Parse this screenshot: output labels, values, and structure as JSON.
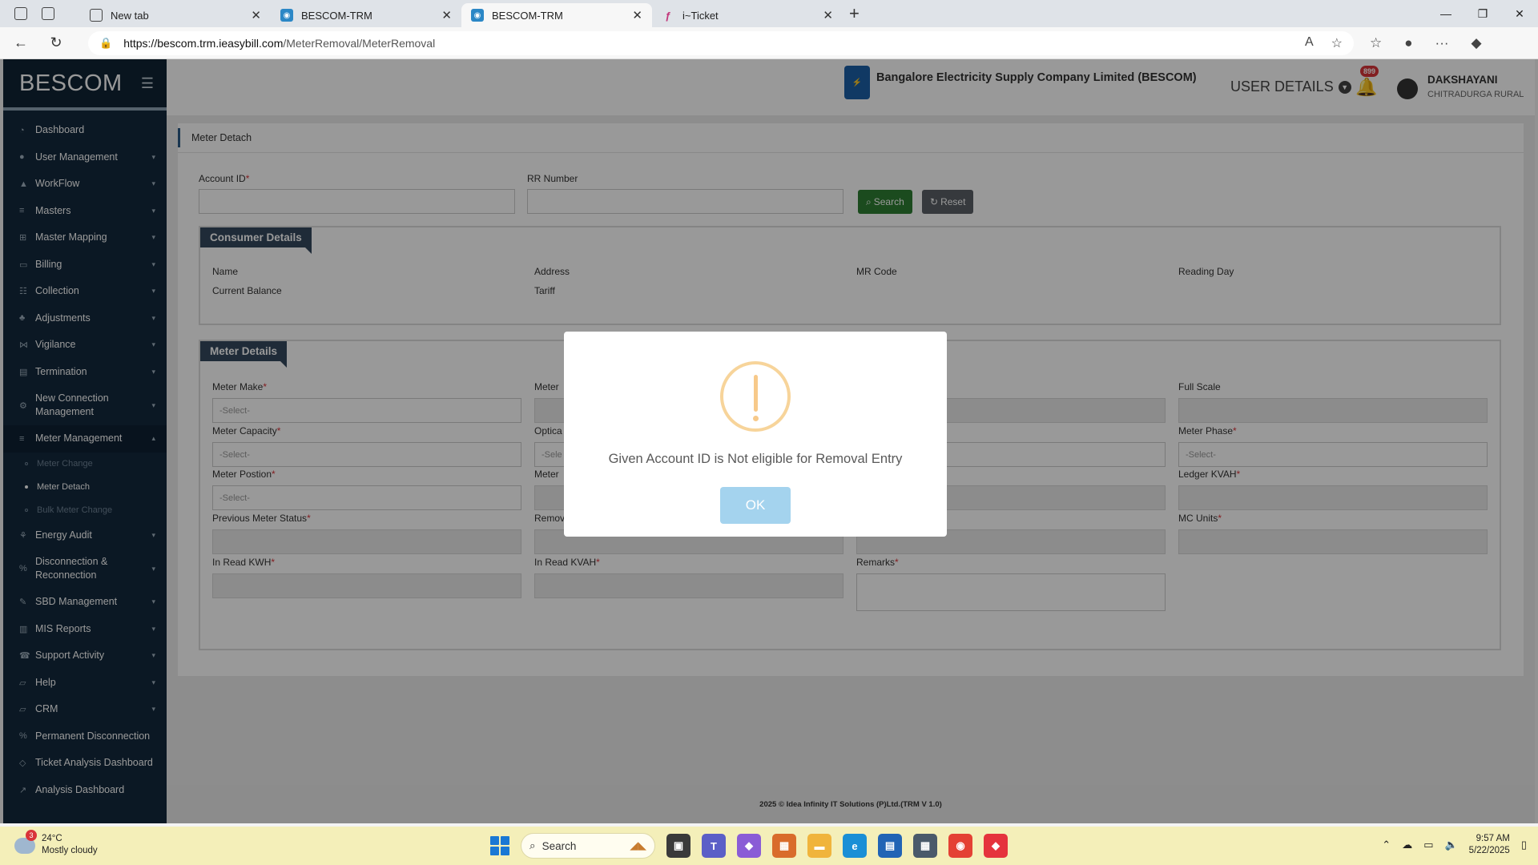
{
  "browser": {
    "tabs": [
      {
        "label": "New tab",
        "icon": "newtab-icon",
        "active": false
      },
      {
        "label": "BESCOM-TRM",
        "icon": "bescom-favicon",
        "active": false
      },
      {
        "label": "BESCOM-TRM",
        "icon": "bescom-favicon",
        "active": true
      },
      {
        "label": "i~Ticket",
        "icon": "iticket-favicon",
        "active": false
      }
    ],
    "url_host": "https://bescom.trm.ieasybill.com",
    "url_path": "/MeterRemoval/MeterRemoval"
  },
  "sidebar": {
    "brand": "BESCOM",
    "items": [
      {
        "label": "Dashboard",
        "icon": "dashboard-icon",
        "chevron": false
      },
      {
        "label": "User Management",
        "icon": "user-icon",
        "chevron": true
      },
      {
        "label": "WorkFlow",
        "icon": "workflow-icon",
        "chevron": true
      },
      {
        "label": "Masters",
        "icon": "masters-icon",
        "chevron": true
      },
      {
        "label": "Master Mapping",
        "icon": "mapping-icon",
        "chevron": true
      },
      {
        "label": "Billing",
        "icon": "billing-icon",
        "chevron": true
      },
      {
        "label": "Collection",
        "icon": "collection-icon",
        "chevron": true
      },
      {
        "label": "Adjustments",
        "icon": "adjustments-icon",
        "chevron": true
      },
      {
        "label": "Vigilance",
        "icon": "vigilance-icon",
        "chevron": true
      },
      {
        "label": "Termination",
        "icon": "termination-icon",
        "chevron": true
      },
      {
        "label": "New Connection Management",
        "icon": "connection-icon",
        "chevron": true
      },
      {
        "label": "Meter Management",
        "icon": "meter-icon",
        "chevron": true
      },
      {
        "label": "Meter Change",
        "sub": true
      },
      {
        "label": "Meter Detach",
        "sub": true
      },
      {
        "label": "Bulk Meter Change",
        "sub": true
      },
      {
        "label": "Energy Audit",
        "icon": "energy-icon",
        "chevron": true
      },
      {
        "label": "Disconnection & Reconnection",
        "icon": "disconnection-icon",
        "chevron": true
      },
      {
        "label": "SBD Management",
        "icon": "sbd-icon",
        "chevron": true
      },
      {
        "label": "MIS Reports",
        "icon": "reports-icon",
        "chevron": true
      },
      {
        "label": "Support Activity",
        "icon": "support-icon",
        "chevron": true
      },
      {
        "label": "Help",
        "icon": "help-icon",
        "chevron": true
      },
      {
        "label": "CRM",
        "icon": "crm-icon",
        "chevron": true
      },
      {
        "label": "Permanent Disconnection",
        "icon": "permanent-icon",
        "chevron": false
      },
      {
        "label": "Ticket Analysis Dashboard",
        "icon": "ticket-icon",
        "chevron": false
      },
      {
        "label": "Analysis Dashboard",
        "icon": "analysis-icon",
        "chevron": false
      }
    ]
  },
  "header": {
    "company": "Bangalore Electricity Supply Company Limited (BESCOM)",
    "user_details": "USER DETAILS",
    "notif_count": "899",
    "user_name": "DAKSHAYANI",
    "user_role": "CHITRADURGA RURAL"
  },
  "page": {
    "title": "Meter Detach",
    "account_id_label": "Account ID",
    "rr_number_label": "RR Number",
    "search_label": "Search",
    "reset_label": "Reset"
  },
  "consumer": {
    "title": "Consumer Details",
    "labels": [
      "Name",
      "Address",
      "MR Code",
      "Reading Day",
      "Current Balance",
      "Tariff"
    ]
  },
  "meter": {
    "title": "Meter Details",
    "row1": [
      "Meter Make",
      "Meter",
      "",
      "Full Scale"
    ],
    "row2": [
      "Meter Capacity",
      "Optica",
      "",
      "Meter Phase"
    ],
    "row3": [
      "Meter Postion",
      "Meter",
      "",
      "Ledger KVAH"
    ],
    "row4": [
      "Previous Meter Status",
      "Remov",
      "",
      "MC Units"
    ],
    "row5": [
      "In Read KWH",
      "In Read KVAH",
      "Remarks"
    ],
    "select_placeholder": "-Select-",
    "select_placeholder_cut": "-Sele"
  },
  "footer": "2025 © Idea Infinity IT Solutions (P)Ltd.(TRM V 1.0)",
  "modal": {
    "message": "Given Account ID is Not eligible for Removal Entry",
    "ok_label": "OK"
  },
  "taskbar": {
    "weather_badge": "3",
    "temp": "24°C",
    "condition": "Mostly cloudy",
    "search": "Search",
    "time": "9:57 AM",
    "date": "5/22/2025"
  },
  "colors": {
    "sidebar": "#13293c",
    "search_button": "#2e7d32",
    "reset_button": "#5a5f66",
    "section_title": "#34495e",
    "ok_button": "#a4d3ee",
    "warning": "#f7c98a"
  }
}
